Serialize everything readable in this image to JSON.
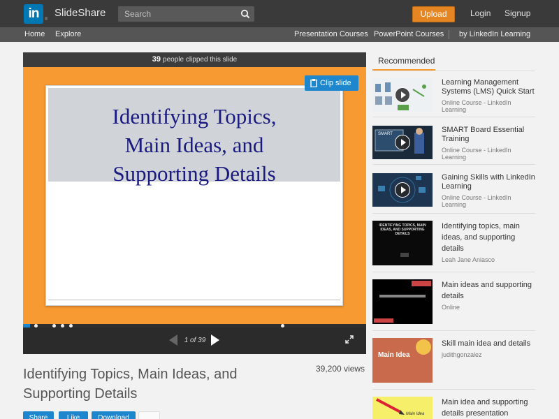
{
  "header": {
    "logo_text": "in",
    "brand": "SlideShare",
    "search_placeholder": "Search",
    "upload": "Upload",
    "login": "Login",
    "signup": "Signup"
  },
  "nav": {
    "home": "Home",
    "explore": "Explore",
    "presentation_courses": "Presentation Courses",
    "powerpoint_courses": "PowerPoint Courses",
    "by_linkedin": "by LinkedIn Learning"
  },
  "player": {
    "clip_count": "39",
    "clip_text": "people clipped this slide",
    "clip_button": "Clip slide",
    "slide_title_line1": "Identifying Topics,",
    "slide_title_line2": "Main Ideas, and",
    "slide_title_line3": "Supporting Details",
    "page_indicator": "1 of 39",
    "progress_fraction": 0.02
  },
  "presentation": {
    "title_line1": "Identifying Topics, Main Ideas, and",
    "title_line2": "Supporting Details",
    "views": "39,200 views",
    "actions": [
      "Share",
      "Like",
      "Download"
    ]
  },
  "sidebar": {
    "tab": "Recommended",
    "items": [
      {
        "title": "Learning Management Systems (LMS) Quick Start",
        "subtitle": "Online Course - LinkedIn Learning",
        "thumb": "course-lms"
      },
      {
        "title": "SMART Board Essential Training",
        "subtitle": "Online Course - LinkedIn Learning",
        "thumb": "course-smart"
      },
      {
        "title": "Gaining Skills with LinkedIn Learning",
        "subtitle": "Online Course - LinkedIn Learning",
        "thumb": "course-skills"
      },
      {
        "title": "Identifying topics, main ideas, and supporting details",
        "subtitle": "Leah Jane Aniasco",
        "thumb": "slides-dark"
      },
      {
        "title": "Main ideas and supporting details",
        "subtitle": "Online",
        "thumb": "slides-black"
      },
      {
        "title": "Skill main idea and details",
        "subtitle": "judithgonzalez",
        "thumb": "slides-mainidea"
      },
      {
        "title": "Main idea and supporting details presentation",
        "subtitle": "",
        "thumb": "slides-yellow"
      }
    ],
    "thumb_labels": {
      "smart": "SMART",
      "dark_slide": "IDENTIFYING TOPICS, MAIN IDEAS, AND SUPPORTING DETAILS",
      "main_idea": "Main Idea",
      "yellow": "Main Idea"
    }
  }
}
